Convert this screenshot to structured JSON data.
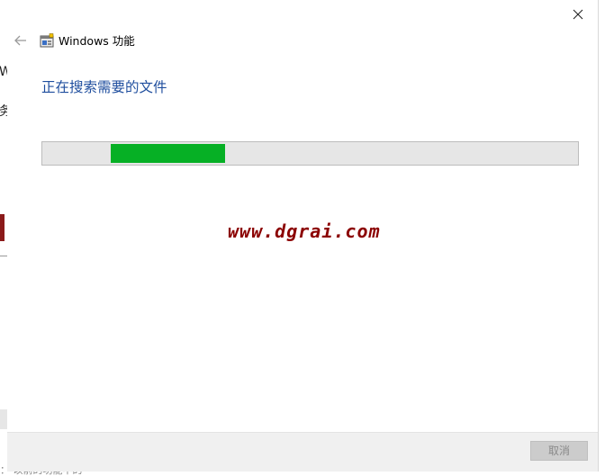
{
  "background_window": {
    "chars": [
      "W",
      "务"
    ],
    "bottom_text": "：  以前的功能中的"
  },
  "dialog": {
    "title": "Windows 功能",
    "heading": "正在搜索需要的文件",
    "progress": {
      "start_fraction": 0.128,
      "end_fraction": 0.342
    },
    "watermark": "www.dgrai.com",
    "cancel_label": "取消"
  },
  "colors": {
    "heading": "#1f4e9e",
    "progress_fill": "#06b025",
    "progress_track": "#e6e6e6",
    "watermark": "#8b0000",
    "footer": "#f0f0f0"
  },
  "icons": {
    "close": "close-icon",
    "back": "back-arrow-icon",
    "title": "windows-features-icon"
  }
}
